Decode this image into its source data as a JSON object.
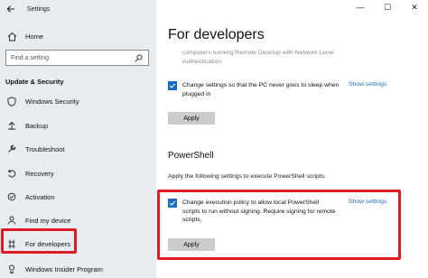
{
  "window": {
    "title": "Settings",
    "minimize_glyph": "—",
    "maximize_glyph": "☐",
    "close_glyph": "✕"
  },
  "sidebar": {
    "home_label": "Home",
    "search_placeholder": "Find a setting",
    "section_header": "Update & Security",
    "items": [
      {
        "label": "Windows Security",
        "icon": "shield-icon"
      },
      {
        "label": "Backup",
        "icon": "backup-icon"
      },
      {
        "label": "Troubleshoot",
        "icon": "wrench-icon"
      },
      {
        "label": "Recovery",
        "icon": "recovery-icon"
      },
      {
        "label": "Activation",
        "icon": "activation-icon"
      },
      {
        "label": "Find my device",
        "icon": "person-icon"
      },
      {
        "label": "For developers",
        "icon": "developer-icon"
      },
      {
        "label": "Windows Insider Program",
        "icon": "insider-icon"
      }
    ],
    "selected": "For developers"
  },
  "main": {
    "title": "For developers",
    "truncated_text": "computers running Remote Desktop with Network Level Authentication",
    "sleep_option": {
      "label": "Change settings so that the PC never goes to sleep when plugged in",
      "checked": true,
      "link": "Show settings",
      "apply": "Apply"
    },
    "powershell": {
      "heading": "PowerShell",
      "description": "Apply the following settings to execute PowerShell scripts.",
      "option": {
        "label": "Change execution policy to allow local PowerShell scripts to run without signing. Require signing for remote scripts.",
        "checked": true,
        "link": "Show settings",
        "apply": "Apply"
      }
    }
  },
  "colors": {
    "sidebar_bg": "#e6ecf0",
    "accent": "#1b6dc1",
    "highlight": "#e11b22",
    "button": "#cccccc"
  }
}
